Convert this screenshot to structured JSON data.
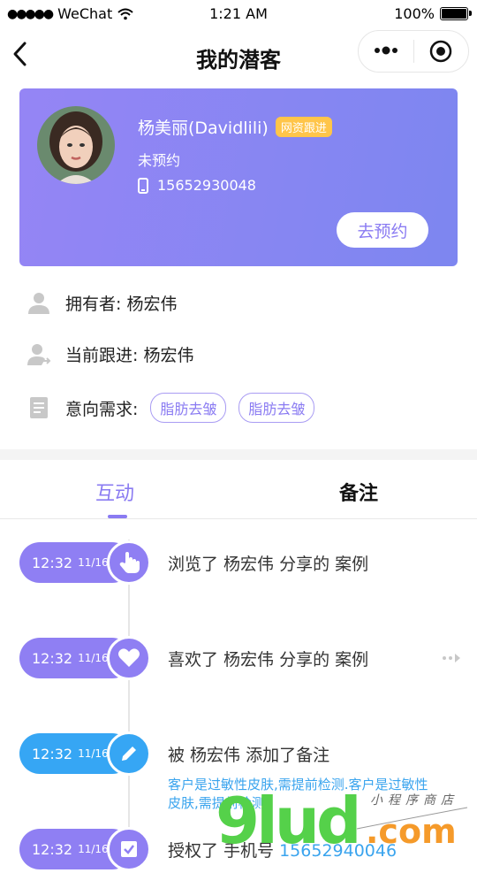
{
  "status_bar": {
    "carrier": "WeChat",
    "time": "1:21 AM",
    "battery": "100%"
  },
  "nav": {
    "title": "我的潜客"
  },
  "profile": {
    "name": "杨美丽(Davidlili)",
    "badge": "网资跟进",
    "appointment_status": "未预约",
    "phone": "15652930048",
    "book_button": "去预约"
  },
  "details": {
    "owner_label": "拥有者: 杨宏伟",
    "follower_label": "当前跟进: 杨宏伟",
    "intent_label": "意向需求:",
    "intent_tags": [
      "脂肪去皱",
      "脂肪去皱"
    ]
  },
  "tabs": {
    "interaction": "互动",
    "notes": "备注"
  },
  "timeline": [
    {
      "time": "12:32",
      "date": "11/16",
      "icon": "hand-pointer-icon",
      "text": "浏览了 杨宏伟 分享的 案例",
      "color": "#8f7ff3"
    },
    {
      "time": "12:32",
      "date": "11/16",
      "icon": "heart-icon",
      "text": "喜欢了 杨宏伟 分享的 案例",
      "color": "#8f7ff3"
    },
    {
      "time": "12:32",
      "date": "11/16",
      "icon": "pencil-icon",
      "text": "被 杨宏伟 添加了备注",
      "note": "客户是过敏性皮肤,需提前检测.客户是过敏性皮肤,需提前检测",
      "color": "#36a6f4"
    },
    {
      "time": "12:32",
      "date": "11/16",
      "icon": "check-icon",
      "text_prefix": "授权了 手机号",
      "text_link": "15652940046",
      "color": "#8f7ff3"
    }
  ],
  "watermark": {
    "text": "9lud.com",
    "subtext": "小程序商店"
  }
}
